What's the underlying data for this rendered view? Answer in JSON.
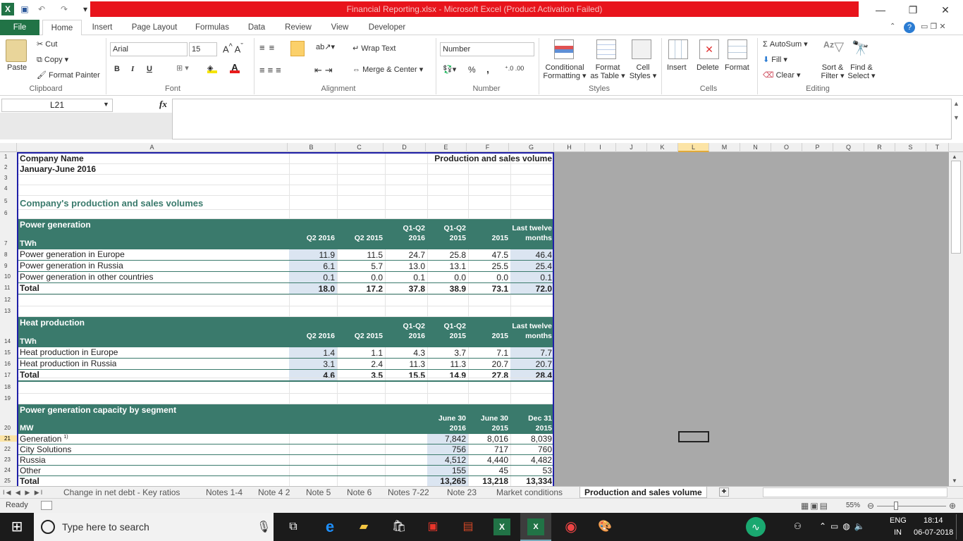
{
  "window": {
    "title": "Financial Reporting.xlsx  -  Microsoft Excel (Product Activation Failed)",
    "minimize": "—",
    "restore": "❐",
    "close": "✕"
  },
  "tabs": [
    "File",
    "Home",
    "Insert",
    "Page Layout",
    "Formulas",
    "Data",
    "Review",
    "View",
    "Developer"
  ],
  "ribbon": {
    "clipboard": {
      "paste": "Paste",
      "cut": "Cut",
      "copy": "Copy",
      "format_painter": "Format Painter",
      "label": "Clipboard"
    },
    "font": {
      "name": "Arial",
      "size": "15",
      "bold": "B",
      "italic": "I",
      "underline": "U",
      "label": "Font"
    },
    "alignment": {
      "wrap": "Wrap Text",
      "merge": "Merge & Center",
      "label": "Alignment"
    },
    "number": {
      "format": "Number",
      "percent": "%",
      "comma": ",",
      "label": "Number"
    },
    "styles": {
      "conditional": "Conditional",
      "conditional2": "Formatting",
      "format_as": "Format",
      "format_as2": "as Table",
      "cell": "Cell",
      "cell2": "Styles",
      "label": "Styles"
    },
    "cells": {
      "insert": "Insert",
      "delete": "Delete",
      "format": "Format",
      "label": "Cells"
    },
    "editing": {
      "autosum": "AutoSum",
      "fill": "Fill",
      "clear": "Clear",
      "sort": "Sort &",
      "sort2": "Filter",
      "find": "Find &",
      "find2": "Select",
      "label": "Editing"
    }
  },
  "formula_bar": {
    "name_box": "L21",
    "fx": "fx",
    "value": ""
  },
  "columns": [
    "A",
    "B",
    "C",
    "D",
    "E",
    "F",
    "G",
    "H",
    "I",
    "J",
    "K",
    "L",
    "M",
    "N",
    "O",
    "P",
    "Q",
    "R",
    "S",
    "T"
  ],
  "sheet": {
    "company": "Company Name",
    "period": "January-June 2016",
    "report_title": "Production and sales volume",
    "section_title": "Company's production and sales volumes",
    "power": {
      "title": "Power generation",
      "unit": "TWh",
      "headers": [
        [
          "",
          "Q2 2016"
        ],
        [
          "",
          "Q2 2015"
        ],
        [
          "Q1-Q2",
          "2016"
        ],
        [
          "Q1-Q2",
          "2015"
        ],
        [
          "",
          "2015"
        ],
        [
          "Last twelve",
          "months"
        ]
      ],
      "rows": [
        {
          "label": "Power generation in Europe",
          "values": [
            "11.9",
            "11.5",
            "24.7",
            "25.8",
            "47.5",
            "46.4"
          ]
        },
        {
          "label": "Power generation in Russia",
          "values": [
            "6.1",
            "5.7",
            "13.0",
            "13.1",
            "25.5",
            "25.4"
          ]
        },
        {
          "label": "Power generation in other countries",
          "values": [
            "0.1",
            "0.0",
            "0.1",
            "0.0",
            "0.0",
            "0.1"
          ]
        }
      ],
      "total": {
        "label": "Total",
        "values": [
          "18.0",
          "17.2",
          "37.8",
          "38.9",
          "73.1",
          "72.0"
        ]
      }
    },
    "heat": {
      "title": "Heat production",
      "unit": "TWh",
      "headers": [
        [
          "",
          "Q2 2016"
        ],
        [
          "",
          "Q2 2015"
        ],
        [
          "Q1-Q2",
          "2016"
        ],
        [
          "Q1-Q2",
          "2015"
        ],
        [
          "",
          "2015"
        ],
        [
          "Last twelve",
          "months"
        ]
      ],
      "rows": [
        {
          "label": "Heat production in Europe",
          "values": [
            "1.4",
            "1.1",
            "4.3",
            "3.7",
            "7.1",
            "7.7"
          ]
        },
        {
          "label": "Heat production in Russia",
          "values": [
            "3.1",
            "2.4",
            "11.3",
            "11.3",
            "20.7",
            "20.7"
          ]
        }
      ],
      "total": {
        "label": "Total",
        "values": [
          "4.6",
          "3.5",
          "15.5",
          "14.9",
          "27.8",
          "28.4"
        ]
      }
    },
    "capacity": {
      "title": "Power generation capacity by segment",
      "unit": "MW",
      "headers": [
        [
          "June 30",
          "2016"
        ],
        [
          "June 30",
          "2015"
        ],
        [
          "Dec 31",
          "2015"
        ]
      ],
      "rows": [
        {
          "label": "Generation",
          "sup": "1)",
          "values": [
            "7,842",
            "8,016",
            "8,039"
          ]
        },
        {
          "label": "City Solutions",
          "values": [
            "756",
            "717",
            "760"
          ]
        },
        {
          "label": "Russia",
          "values": [
            "4,512",
            "4,440",
            "4,482"
          ]
        },
        {
          "label": "Other",
          "values": [
            "155",
            "45",
            "53"
          ]
        }
      ],
      "total": {
        "label": "Total",
        "values": [
          "13,265",
          "13,218",
          "13,334"
        ]
      }
    }
  },
  "sheet_tabs": [
    "Change in net debt - Key ratios",
    "Notes 1-4",
    "Note 4 2",
    "Note 5",
    "Note 6",
    "Notes 7-22",
    "Note 23",
    "Market conditions",
    "Production and sales volume"
  ],
  "status": {
    "ready": "Ready",
    "zoom": "55%"
  },
  "taskbar": {
    "search": "Type here to search",
    "lang1": "ENG",
    "lang2": "IN",
    "time": "18:14",
    "date": "06-07-2018"
  }
}
